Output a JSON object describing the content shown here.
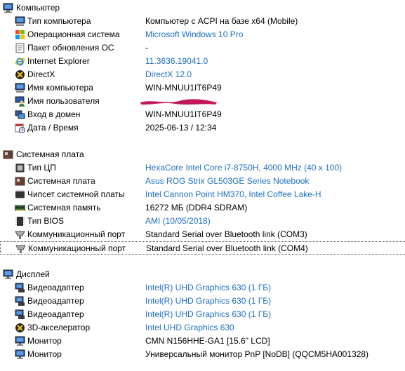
{
  "sections": [
    {
      "title": "Компьютер",
      "icon": "computer-icon",
      "items": [
        {
          "label": "Тип компьютера",
          "value": "Компьютер с ACPI на базе x64  (Mobile)",
          "link": false,
          "icon": "computer-icon"
        },
        {
          "label": "Операционная система",
          "value": "Microsoft Windows 10 Pro",
          "link": true,
          "icon": "windows-logo-icon"
        },
        {
          "label": "Пакет обновления ОС",
          "value": "-",
          "link": false,
          "icon": "update-pack-icon"
        },
        {
          "label": "Internet Explorer",
          "value": "11.3636.19041.0",
          "link": true,
          "icon": "internet-explorer-icon"
        },
        {
          "label": "DirectX",
          "value": "DirectX 12.0",
          "link": true,
          "icon": "directx-icon"
        },
        {
          "label": "Имя компьютера",
          "value": "WIN-MNUU1IT6P49",
          "link": false,
          "icon": "computer-icon"
        },
        {
          "label": "Имя пользователя",
          "value": "",
          "link": false,
          "icon": "user-icon",
          "redacted": true
        },
        {
          "label": "Вход в домен",
          "value": "WIN-MNUU1IT6P49",
          "link": false,
          "icon": "domain-login-icon"
        },
        {
          "label": "Дата / Время",
          "value": "2025-06-13 / 12:34",
          "link": false,
          "icon": "calendar-clock-icon"
        }
      ]
    },
    {
      "title": "Системная плата",
      "icon": "motherboard-icon",
      "items": [
        {
          "label": "Тип ЦП",
          "value": "HexaCore Intel Core i7-8750H, 4000 MHz (40 x 100)",
          "link": true,
          "icon": "cpu-icon"
        },
        {
          "label": "Системная плата",
          "value": "Asus ROG Strix GL503GE Series Notebook",
          "link": true,
          "icon": "motherboard-icon"
        },
        {
          "label": "Чипсет системной платы",
          "value": "Intel Cannon Point HM370, Intel Coffee Lake-H",
          "link": true,
          "icon": "chipset-icon"
        },
        {
          "label": "Системная память",
          "value": "16272 МБ  (DDR4 SDRAM)",
          "link": false,
          "icon": "memory-icon"
        },
        {
          "label": "Тип BIOS",
          "value": "AMI (10/05/2018)",
          "link": true,
          "icon": "bios-chip-icon"
        },
        {
          "label": "Коммуникационный порт",
          "value": "Standard Serial over Bluetooth link (COM3)",
          "link": false,
          "icon": "serial-port-icon"
        },
        {
          "label": "Коммуникационный порт",
          "value": "Standard Serial over Bluetooth link (COM4)",
          "link": false,
          "icon": "serial-port-icon",
          "selected": true
        }
      ]
    },
    {
      "title": "Дисплей",
      "icon": "monitor-icon",
      "items": [
        {
          "label": "Видеоадаптер",
          "value": "Intel(R) UHD Graphics 630  (1 ГБ)",
          "link": true,
          "icon": "video-adapter-icon"
        },
        {
          "label": "Видеоадаптер",
          "value": "Intel(R) UHD Graphics 630  (1 ГБ)",
          "link": true,
          "icon": "video-adapter-icon"
        },
        {
          "label": "Видеоадаптер",
          "value": "Intel(R) UHD Graphics 630  (1 ГБ)",
          "link": true,
          "icon": "video-adapter-icon"
        },
        {
          "label": "3D-акселератор",
          "value": "Intel UHD Graphics 630",
          "link": true,
          "icon": "3d-accelerator-icon"
        },
        {
          "label": "Монитор",
          "value": "CMN N156HHE-GA1  [15.6\" LCD]",
          "link": false,
          "icon": "monitor-icon"
        },
        {
          "label": "Монитор",
          "value": "Универсальный монитор PnP [NoDB]  (QQCM5HA001328)",
          "link": false,
          "icon": "monitor-icon"
        }
      ]
    }
  ],
  "colors": {
    "link": "#1e6fc1",
    "redaction": "#c2185b"
  }
}
